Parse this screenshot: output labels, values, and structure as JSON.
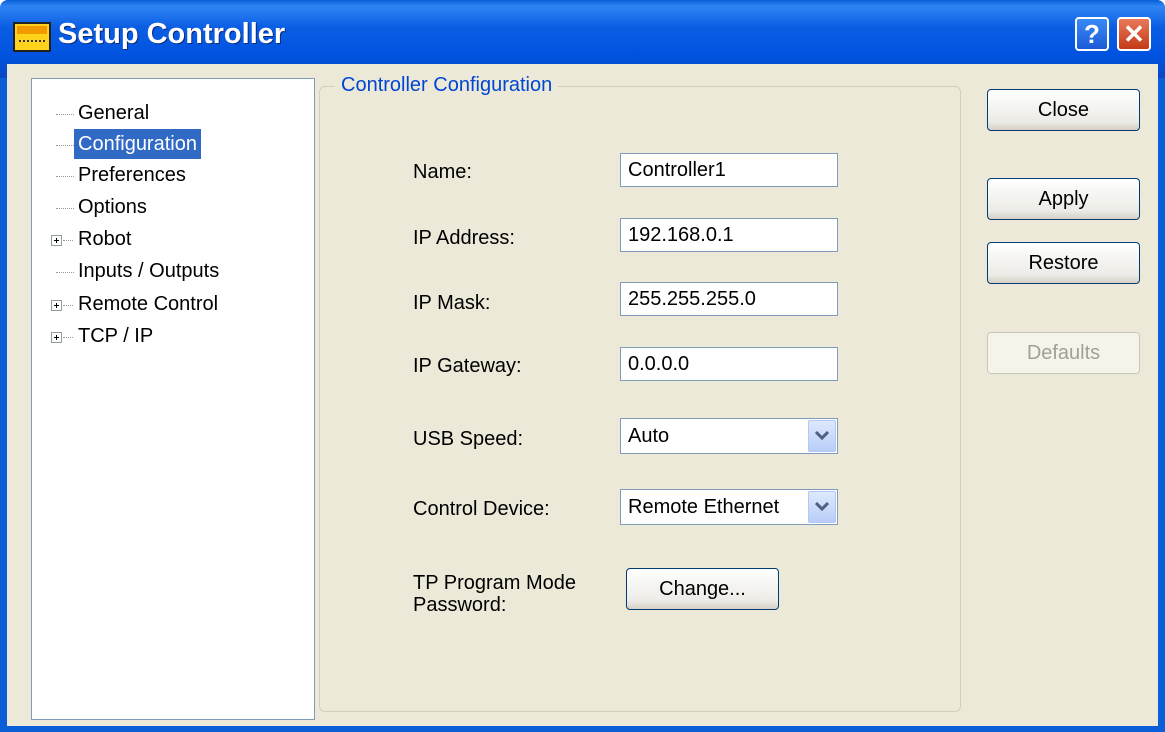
{
  "window": {
    "title": "Setup Controller",
    "help_glyph": "?",
    "close_glyph": "✕"
  },
  "tree": {
    "items": [
      {
        "label": "General",
        "expandable": false,
        "selected": false
      },
      {
        "label": "Configuration",
        "expandable": false,
        "selected": true
      },
      {
        "label": "Preferences",
        "expandable": false,
        "selected": false
      },
      {
        "label": "Options",
        "expandable": false,
        "selected": false
      },
      {
        "label": "Robot",
        "expandable": true,
        "selected": false
      },
      {
        "label": "Inputs / Outputs",
        "expandable": false,
        "selected": false
      },
      {
        "label": "Remote Control",
        "expandable": true,
        "selected": false
      },
      {
        "label": "TCP / IP",
        "expandable": true,
        "selected": false
      }
    ]
  },
  "group": {
    "title": "Controller Configuration"
  },
  "form": {
    "name": {
      "label": "Name:",
      "value": "Controller1"
    },
    "ip_address": {
      "label": "IP Address:",
      "value": "192.168.0.1"
    },
    "ip_mask": {
      "label": "IP Mask:",
      "value": "255.255.255.0"
    },
    "ip_gateway": {
      "label": "IP Gateway:",
      "value": "0.0.0.0"
    },
    "usb_speed": {
      "label": "USB Speed:",
      "value": "Auto"
    },
    "control_device": {
      "label": "Control Device:",
      "value": "Remote Ethernet"
    },
    "tp_password": {
      "label_line1": "TP Program Mode",
      "label_line2": "Password:",
      "button": "Change..."
    }
  },
  "buttons": {
    "close": "Close",
    "apply": "Apply",
    "restore": "Restore",
    "defaults": "Defaults"
  },
  "icons": {
    "app": "controller-app-icon",
    "help": "help-icon",
    "close": "close-icon",
    "dropdown": "chevron-down-icon",
    "expand": "plus-box-icon"
  }
}
